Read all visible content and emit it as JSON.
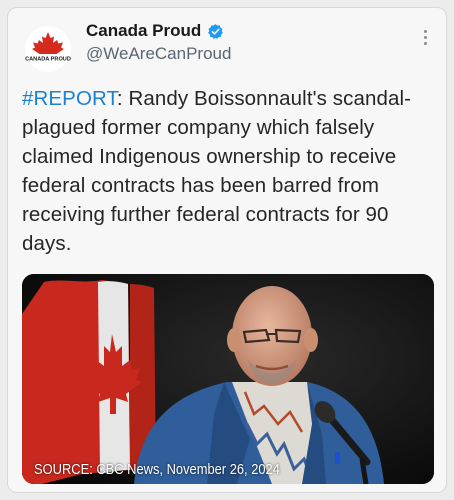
{
  "account": {
    "name": "Canada Proud",
    "handle": "@WeAreCanProud",
    "avatar_text": "CANADA PROUD",
    "verified_icon": "verified-badge-icon",
    "more_icon": "more-options-icon"
  },
  "post": {
    "hashtag": "#REPORT",
    "separator": ":",
    "body": " Randy Boissonnault's scandal-plagued former company which falsely claimed Indigenous ownership to receive federal contracts has been barred from receiving further federal contracts for 90 days."
  },
  "media": {
    "caption": "SOURCE: CBC News, November 26, 2024"
  },
  "colors": {
    "hashtag": "#1d7fd1",
    "verified": "#1d9bf0",
    "maple_red": "#d52b1e"
  }
}
